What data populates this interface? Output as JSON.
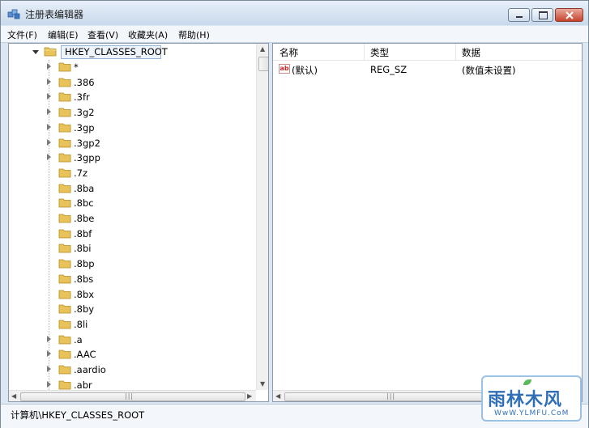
{
  "window": {
    "title": "注册表编辑器",
    "icon": "registry-editor-icon"
  },
  "menu": [
    "文件(F)",
    "编辑(E)",
    "查看(V)",
    "收藏夹(A)",
    "帮助(H)"
  ],
  "tree": {
    "root": "HKEY_CLASSES_ROOT",
    "items": [
      {
        "label": "*",
        "expandable": true
      },
      {
        "label": ".386",
        "expandable": true
      },
      {
        "label": ".3fr",
        "expandable": true
      },
      {
        "label": ".3g2",
        "expandable": true
      },
      {
        "label": ".3gp",
        "expandable": true
      },
      {
        "label": ".3gp2",
        "expandable": true
      },
      {
        "label": ".3gpp",
        "expandable": true
      },
      {
        "label": ".7z",
        "expandable": false
      },
      {
        "label": ".8ba",
        "expandable": false
      },
      {
        "label": ".8bc",
        "expandable": false
      },
      {
        "label": ".8be",
        "expandable": false
      },
      {
        "label": ".8bf",
        "expandable": false
      },
      {
        "label": ".8bi",
        "expandable": false
      },
      {
        "label": ".8bp",
        "expandable": false
      },
      {
        "label": ".8bs",
        "expandable": false
      },
      {
        "label": ".8bx",
        "expandable": false
      },
      {
        "label": ".8by",
        "expandable": false
      },
      {
        "label": ".8li",
        "expandable": false
      },
      {
        "label": ".a",
        "expandable": true
      },
      {
        "label": ".AAC",
        "expandable": true
      },
      {
        "label": ".aardio",
        "expandable": true
      },
      {
        "label": ".abr",
        "expandable": true
      }
    ]
  },
  "list": {
    "headers": [
      "名称",
      "类型",
      "数据"
    ],
    "rows": [
      {
        "name": "(默认)",
        "type": "REG_SZ",
        "data": "(数值未设置)",
        "icon": "string-value-icon"
      }
    ]
  },
  "statusbar": "计算机\\HKEY_CLASSES_ROOT",
  "watermark": {
    "main": "雨林木风",
    "sub": "WwW.YLMFU.CoM"
  },
  "colors": {
    "folder": "#e8c35a",
    "selection_border": "#94b3da",
    "watermark": "#2f6fb8"
  }
}
